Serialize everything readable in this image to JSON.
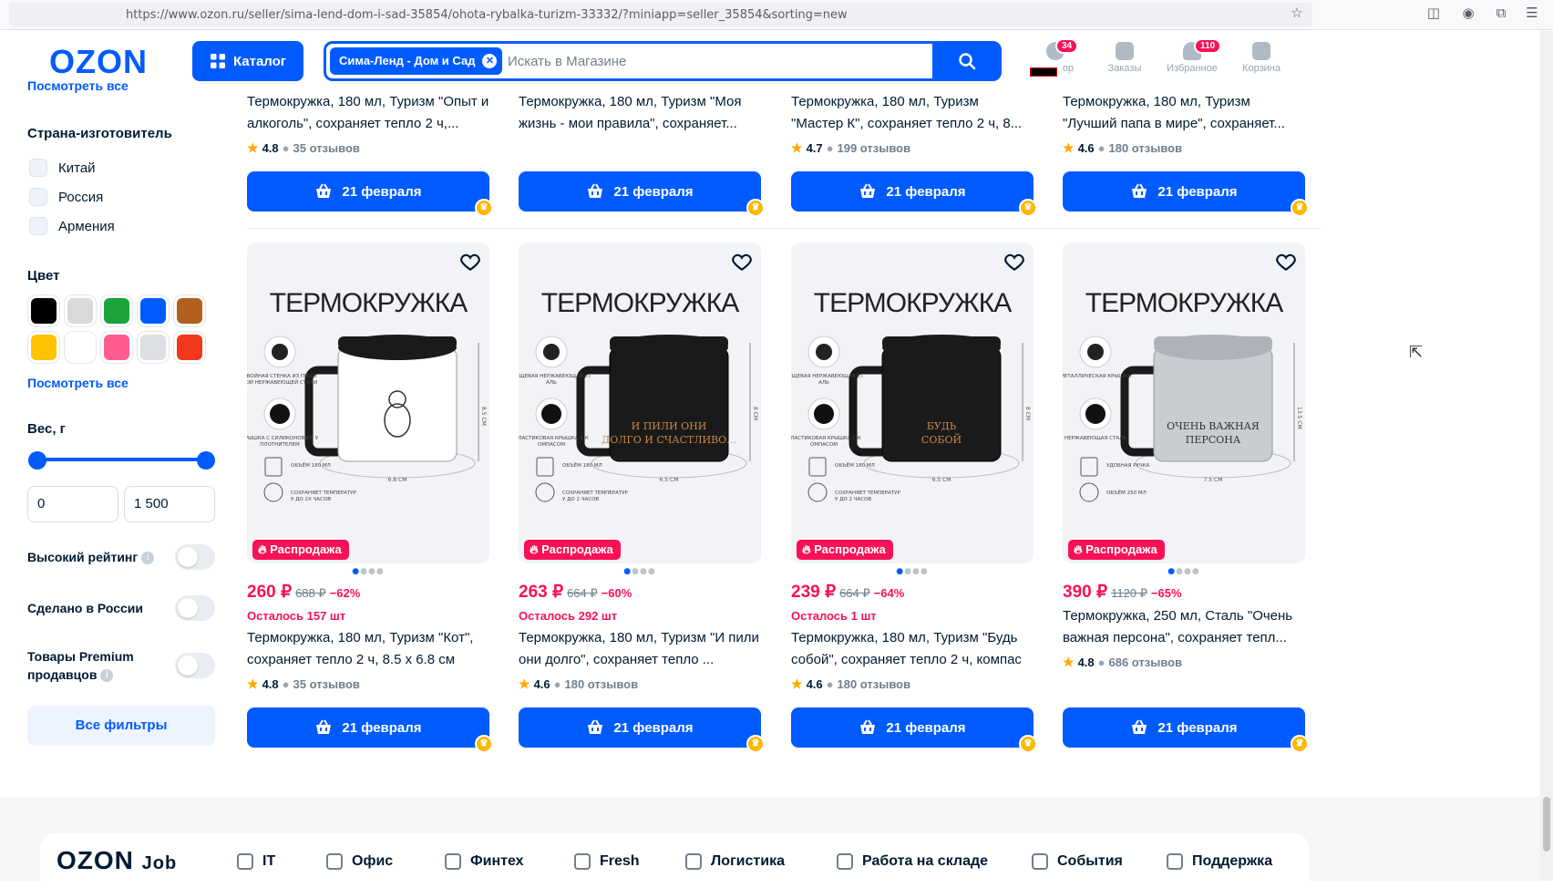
{
  "browser": {
    "url": "https://www.ozon.ru/seller/sima-lend-dom-i-sad-35854/ohota-rybalka-turizm-33332/?miniapp=seller_35854&sorting=new"
  },
  "header": {
    "logo": "OZON",
    "catalog_label": "Каталог",
    "search_chip": "Сима-Ленд - Дом и Сад",
    "search_placeholder": "Искать в Магазине",
    "items": [
      {
        "label": "ор",
        "badge": "34",
        "icon": "user-icon"
      },
      {
        "label": "Заказы",
        "badge": "",
        "icon": "box-icon"
      },
      {
        "label": "Избранное",
        "badge": "110",
        "icon": "heart-icon"
      },
      {
        "label": "Корзина",
        "badge": "",
        "icon": "cart-icon"
      }
    ]
  },
  "sidebar": {
    "see_all_top": "Посмотреть все",
    "country_title": "Страна-изготовитель",
    "countries": [
      "Китай",
      "Россия",
      "Армения"
    ],
    "color_title": "Цвет",
    "colors": [
      "#000000",
      "#d9d9d9",
      "#1aa33a",
      "#005bff",
      "#b3601e",
      "#ffc300",
      "#ffffff",
      "#ff5c8d",
      "#dcdfe3",
      "#f2371b"
    ],
    "see_all_colors": "Посмотреть все",
    "weight_title": "Вес, г",
    "weight_min": "0",
    "weight_max": "1 500",
    "toggles": [
      {
        "label": "Высокий рейтинг",
        "info": true
      },
      {
        "label": "Сделано в России",
        "info": false
      },
      {
        "label": "Товары Premium продавцов",
        "info": true
      }
    ],
    "all_filters": "Все фильтры"
  },
  "top_row": [
    {
      "title": "Термокружка, 180 мл, Туризм \"Опыт и алкоголь\", сохраняет тепло 2 ч,...",
      "rating": "4.8",
      "reviews": "35 отзывов",
      "delivery": "21 февраля"
    },
    {
      "title": "Термокружка, 180 мл, Туризм \"Моя жизнь - мои правила\", сохраняет...",
      "rating": "",
      "reviews": "",
      "delivery": "21 февраля"
    },
    {
      "title": "Термокружка, 180 мл, Туризм \"Мастер К\", сохраняет тепло 2 ч, 8...",
      "rating": "4.7",
      "reviews": "199 отзывов",
      "delivery": "21 февраля"
    },
    {
      "title": "Термокружка, 180 мл, Туризм \"Лучший папа в мире\", сохраняет...",
      "rating": "4.6",
      "reviews": "180 отзывов",
      "delivery": "21 февраля"
    }
  ],
  "products": [
    {
      "img_title": "ТЕРМОКРУЖКА",
      "sale": "Распродажа",
      "price": "260 ₽",
      "old_price": "688 ₽",
      "discount": "−62%",
      "left": "Осталось 157 шт",
      "title": "Термокружка, 180 мл, Туризм \"Кот\", сохраняет тепло 2 ч, 8.5 х 6.8 см",
      "rating": "4.8",
      "reviews": "35 отзывов",
      "delivery": "21 февраля",
      "mug_color": "#ffffff",
      "mug_text": "",
      "f1": "ДВОЙНАЯ СТЕНКА ИЗ ПИЩЕВОЙ НЕРЖАВЕЮЩЕЙ СТАЛИ",
      "f2": "КРЫШКА С СИЛИКОНОВЫМ УПЛОТНИТЕЛЕМ",
      "f3": "ОБЪЁМ 180 МЛ",
      "f4": "СОХРАНЯЕТ ТЕМПЕРАТУРУ ДО 2Х ЧАСОВ",
      "h": "8.5 СМ",
      "w": "6.8 СМ"
    },
    {
      "img_title": "ТЕРМОКРУЖКА",
      "sale": "Распродажа",
      "price": "263 ₽",
      "old_price": "664 ₽",
      "discount": "−60%",
      "left": "Осталось 292 шт",
      "title": "Термокружка, 180 мл, Туризм \"И пили они долго\", сохраняет тепло ...",
      "rating": "4.6",
      "reviews": "180 отзывов",
      "delivery": "21 февраля",
      "mug_color": "#1a1a1a",
      "mug_text": "И ПИЛИ ОНИ ДОЛГО И СЧАСТЛИВО...",
      "f1": "ПИЩЕВАЯ НЕРЖАВЕЮЩАЯ СТАЛЬ",
      "f2": "ПЛАСТИКОВАЯ КРЫШКА С КОМПАСОМ",
      "f3": "ОБЪЁМ 180 МЛ",
      "f4": "СОХРАНЯЕТ ТЕМПЕРАТУРУ ДО 2 ЧАСОВ",
      "h": "8 СМ",
      "w": "6.5 СМ"
    },
    {
      "img_title": "ТЕРМОКРУЖКА",
      "sale": "Распродажа",
      "price": "239 ₽",
      "old_price": "664 ₽",
      "discount": "−64%",
      "left": "Осталось 1 шт",
      "title": "Термокружка, 180 мл, Туризм \"Будь собой\", сохраняет тепло 2 ч, компас",
      "rating": "4.6",
      "reviews": "180 отзывов",
      "delivery": "21 февраля",
      "mug_color": "#1a1a1a",
      "mug_text": "БУДЬ СОБОЙ",
      "f1": "ПИЩЕВАЯ НЕРЖАВЕЮЩАЯ СТАЛЬ",
      "f2": "ПЛАСТИКОВАЯ КРЫШКА С КОМПАСОМ",
      "f3": "ОБЪЁМ 180 МЛ",
      "f4": "СОХРАНЯЕТ ТЕМПЕРАТУРУ ДО 2 ЧАСОВ",
      "h": "8 СМ",
      "w": "6.5 СМ"
    },
    {
      "img_title": "ТЕРМОКРУЖКА",
      "sale": "Распродажа",
      "price": "390 ₽",
      "old_price": "1120 ₽",
      "discount": "−65%",
      "left": "",
      "title": "Термокружка, 250 мл, Сталь \"Очень важная персона\", сохраняет тепл...",
      "rating": "4.8",
      "reviews": "686 отзывов",
      "delivery": "21 февраля",
      "mug_color": "#c9ccd1",
      "mug_text": "ОЧЕНЬ ВАЖНАЯ ПЕРСОНА",
      "f1": "МЕТАЛЛИЧЕСКАЯ КРЫШКА",
      "f2": "НЕРЖАВЕЮЩАЯ СТАЛЬ",
      "f3": "УДОБНАЯ РУЧКА",
      "f4": "ОБЪЁМ 250 МЛ",
      "h": "13.5 СМ",
      "w": "7.5 СМ"
    }
  ],
  "footer": {
    "logo": "OZON",
    "job": "Job",
    "items": [
      {
        "label": "IT",
        "icon": "monitor-icon"
      },
      {
        "label": "Офис",
        "icon": "briefcase-icon"
      },
      {
        "label": "Финтех",
        "icon": "card-icon"
      },
      {
        "label": "Fresh",
        "icon": "leaf-icon"
      },
      {
        "label": "Логистика",
        "icon": "truck-icon"
      },
      {
        "label": "Работа на складе",
        "icon": "pallet-icon"
      },
      {
        "label": "События",
        "icon": "calendar-icon"
      },
      {
        "label": "Поддержка",
        "icon": "chat-icon"
      }
    ]
  }
}
